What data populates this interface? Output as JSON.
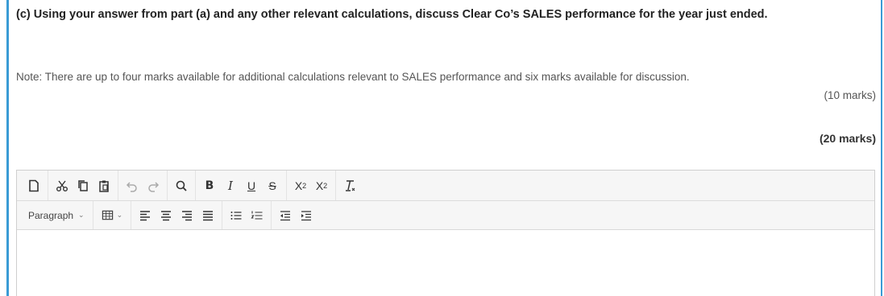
{
  "question": {
    "title": "(c) Using your answer from part (a) and any other relevant calculations, discuss Clear Co’s SALES performance for the year just ended.",
    "note": "Note: There are up to four marks available for additional calculations relevant to SALES performance and six marks available for discussion.",
    "part_marks": "(10 marks)",
    "total_marks": "(20 marks)"
  },
  "editor": {
    "toolbar_row1": [
      "new-document-icon",
      "cut-icon",
      "copy-icon",
      "paste-icon",
      "undo-icon",
      "redo-icon",
      "find-icon",
      "bold-icon",
      "italic-icon",
      "underline-icon",
      "strikethrough-icon",
      "subscript-icon",
      "superscript-icon",
      "clear-formatting-icon"
    ],
    "format_select": "Paragraph",
    "toolbar_row2": [
      "table-icon",
      "align-left-icon",
      "align-center-icon",
      "align-right-icon",
      "align-justify-icon",
      "bullet-list-icon",
      "numbered-list-icon",
      "outdent-icon",
      "indent-icon"
    ],
    "content": ""
  },
  "colors": {
    "accent": "#3a9bd5",
    "toolbar_bg": "#f6f6f6"
  }
}
